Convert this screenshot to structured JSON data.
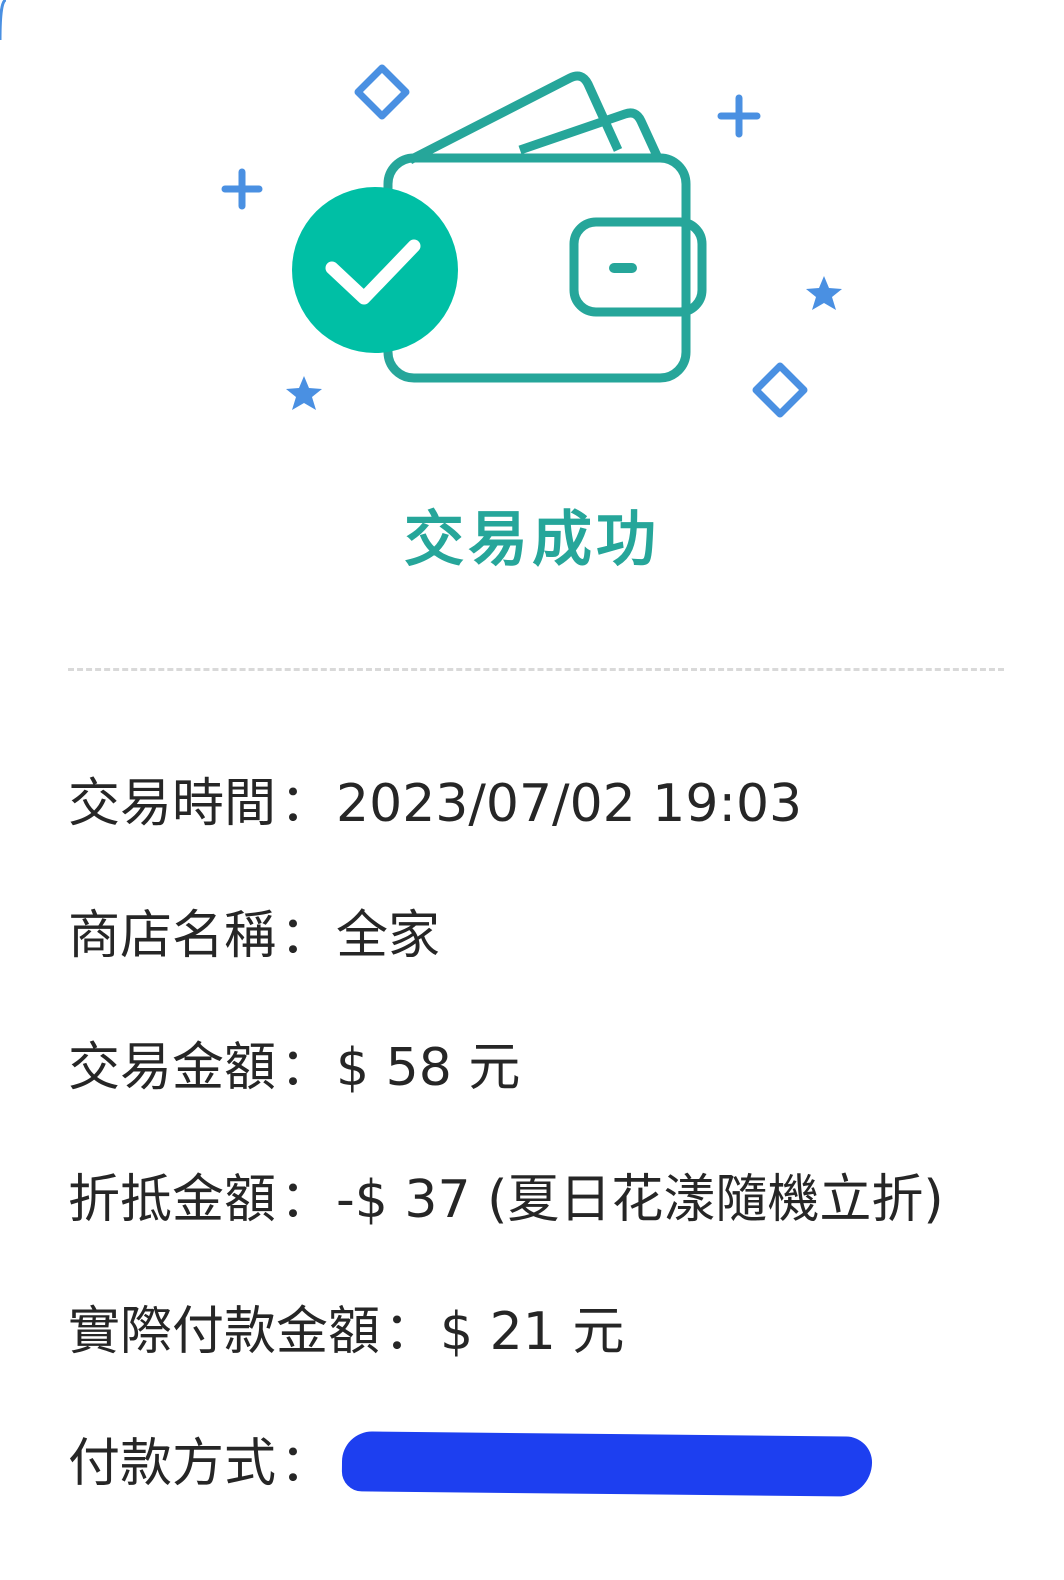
{
  "status": {
    "title": "交易成功",
    "illustration": "wallet-success-icon",
    "accent_color": "#26A69A",
    "sparkle_color": "#4A90E2"
  },
  "details": {
    "separator": "：",
    "rows": [
      {
        "label": "交易時間",
        "value": "2023/07/02 19:03"
      },
      {
        "label": "商店名稱",
        "value": "全家"
      },
      {
        "label": "交易金額",
        "value": "$ 58 元"
      },
      {
        "label": "折抵金額",
        "value": "-$ 37 (夏日花漾隨機立折)"
      },
      {
        "label": "實際付款金額",
        "value": "$ 21 元"
      },
      {
        "label": "付款方式",
        "value": ""
      }
    ],
    "redaction_color": "#1d3ff0"
  }
}
